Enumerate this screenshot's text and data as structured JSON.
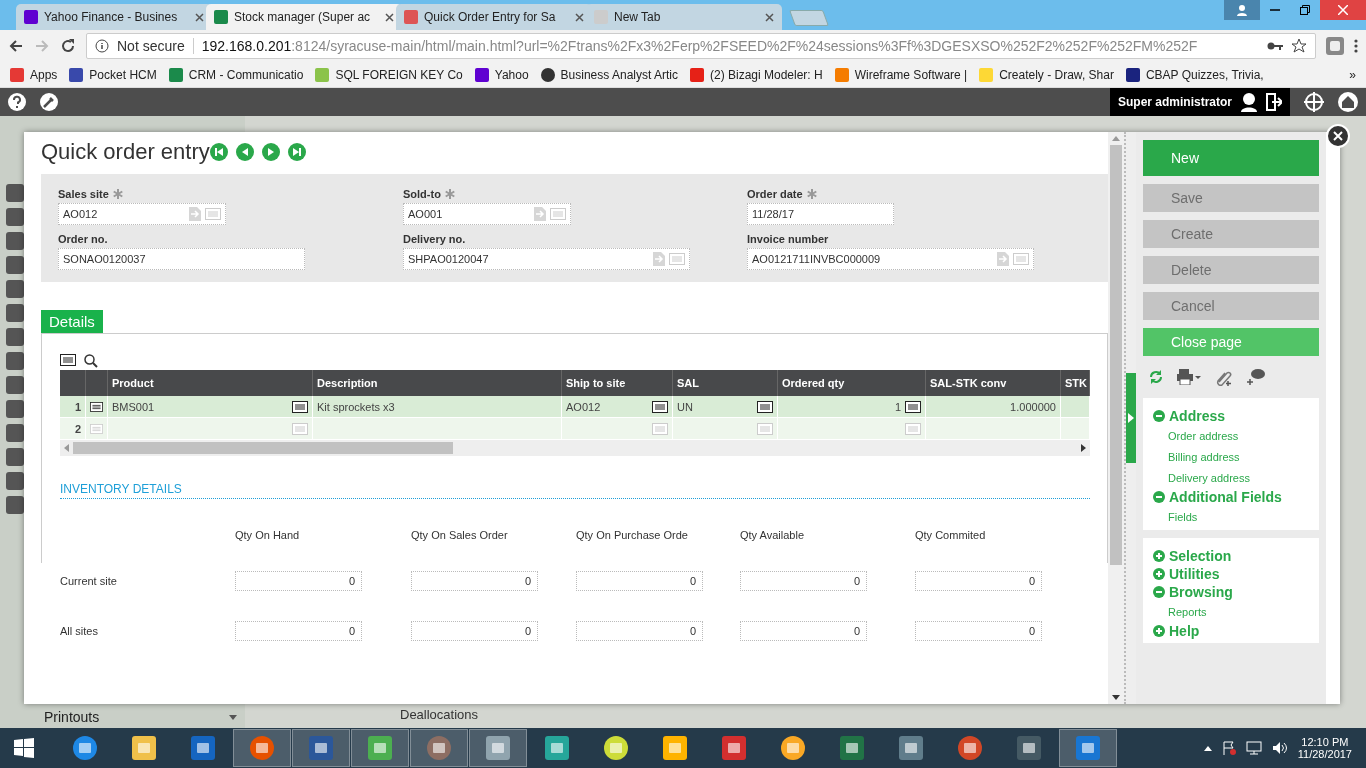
{
  "browser": {
    "tabs": [
      {
        "title": "Yahoo Finance - Busines",
        "selected": false
      },
      {
        "title": "Stock manager (Super ac",
        "selected": true
      },
      {
        "title": "Quick Order Entry for Sa",
        "selected": false
      },
      {
        "title": "New Tab",
        "selected": false
      }
    ],
    "security": "Not secure",
    "host": "192.168.0.201",
    "path": ":8124/syracuse-main/html/main.html?url=%2Ftrans%2Fx3%2Ferp%2FSEED%2F%24sessions%3Ff%3DGESXSO%252F2%252F%252FM%252F",
    "bookmarks": [
      "Apps",
      "Pocket HCM",
      "CRM - Communicatio",
      "SQL FOREIGN KEY Co",
      "Yahoo",
      "Business Analyst Artic",
      "(2) Bizagi Modeler: H",
      "Wireframe Software |",
      "Creately - Draw, Shar",
      "CBAP Quizzes, Trivia,"
    ],
    "more": "»"
  },
  "app": {
    "user": "Super administrator",
    "sidebar_bottom": "Printouts",
    "background_link": "Deallocations"
  },
  "page": {
    "title": "Quick order entry",
    "fields": [
      {
        "label": "Sales site",
        "required": true,
        "value": "AO012",
        "lookup": true
      },
      {
        "label": "Sold-to",
        "required": true,
        "value": "AO001",
        "lookup": true
      },
      {
        "label": "Order date",
        "required": true,
        "value": "11/28/17",
        "lookup": false
      },
      {
        "label": "Order no.",
        "required": false,
        "value": "SONAO0120037",
        "lookup": false
      },
      {
        "label": "Delivery no.",
        "required": false,
        "value": "SHPAO0120047",
        "lookup": true
      },
      {
        "label": "Invoice number",
        "required": false,
        "value": "AO0121711INVBC000009",
        "lookup": true
      }
    ],
    "tab": {
      "label": "Details",
      "selected": true
    },
    "grid": {
      "columns": [
        {
          "label": "Product",
          "lookup": true,
          "kind": "text"
        },
        {
          "label": "Description",
          "lookup": false,
          "kind": "text"
        },
        {
          "label": "Ship to site",
          "lookup": true,
          "kind": "text"
        },
        {
          "label": "SAL",
          "lookup": true,
          "kind": "text"
        },
        {
          "label": "Ordered qty",
          "lookup": true,
          "kind": "number"
        },
        {
          "label": "SAL-STK conv",
          "lookup": false,
          "kind": "number"
        },
        {
          "label": "STK",
          "lookup": false,
          "kind": "text"
        }
      ],
      "rows": [
        {
          "number": "1",
          "selected": true,
          "cells": [
            "BMS001",
            "Kit sprockets x3",
            "AO012",
            "UN",
            "1",
            "1.000000",
            ""
          ]
        },
        {
          "number": "2",
          "selected": false,
          "cells": [
            "",
            "",
            "",
            "",
            "",
            "",
            ""
          ]
        }
      ]
    },
    "inventory": {
      "heading": "INVENTORY DETAILS",
      "columns": [
        "Qty On Hand",
        "Qty On Sales Order",
        "Qty On Purchase Orde",
        "Qty Available",
        "Qty Commited"
      ],
      "rows": [
        {
          "label": "Current site",
          "values": [
            "0",
            "0",
            "0",
            "0",
            "0"
          ]
        },
        {
          "label": "All sites",
          "values": [
            "0",
            "0",
            "0",
            "0",
            "0"
          ]
        }
      ]
    },
    "actions": [
      {
        "label": "New",
        "kind": "primary"
      },
      {
        "label": "Save",
        "kind": "disabled"
      },
      {
        "label": "Create",
        "kind": "disabled"
      },
      {
        "label": "Delete",
        "kind": "disabled"
      },
      {
        "label": "Cancel",
        "kind": "disabled"
      },
      {
        "label": "Close page",
        "kind": "close"
      }
    ],
    "link_panels": [
      [
        {
          "title": "Address",
          "expanded": true,
          "links": [
            "Order address",
            "Billing address",
            "Delivery address"
          ]
        },
        {
          "title": "Additional Fields",
          "expanded": true,
          "links": [
            "Fields"
          ]
        }
      ],
      [
        {
          "title": "Selection",
          "expanded": false
        },
        {
          "title": "Utilities",
          "expanded": false
        },
        {
          "title": "Browsing",
          "expanded": true,
          "links": [
            "Reports"
          ]
        },
        {
          "title": "Help",
          "expanded": false
        }
      ]
    ]
  },
  "taskbar": {
    "apps": [
      {
        "open": false
      },
      {
        "open": false
      },
      {
        "open": false
      },
      {
        "open": true
      },
      {
        "open": true
      },
      {
        "open": true
      },
      {
        "open": true
      },
      {
        "open": true
      },
      {
        "open": false
      },
      {
        "open": false
      },
      {
        "open": false
      },
      {
        "open": false
      },
      {
        "open": false
      },
      {
        "open": false
      },
      {
        "open": false
      },
      {
        "open": false
      },
      {
        "open": false
      },
      {
        "open": true
      }
    ],
    "time": "12:10 PM",
    "date": "11/28/2017"
  }
}
